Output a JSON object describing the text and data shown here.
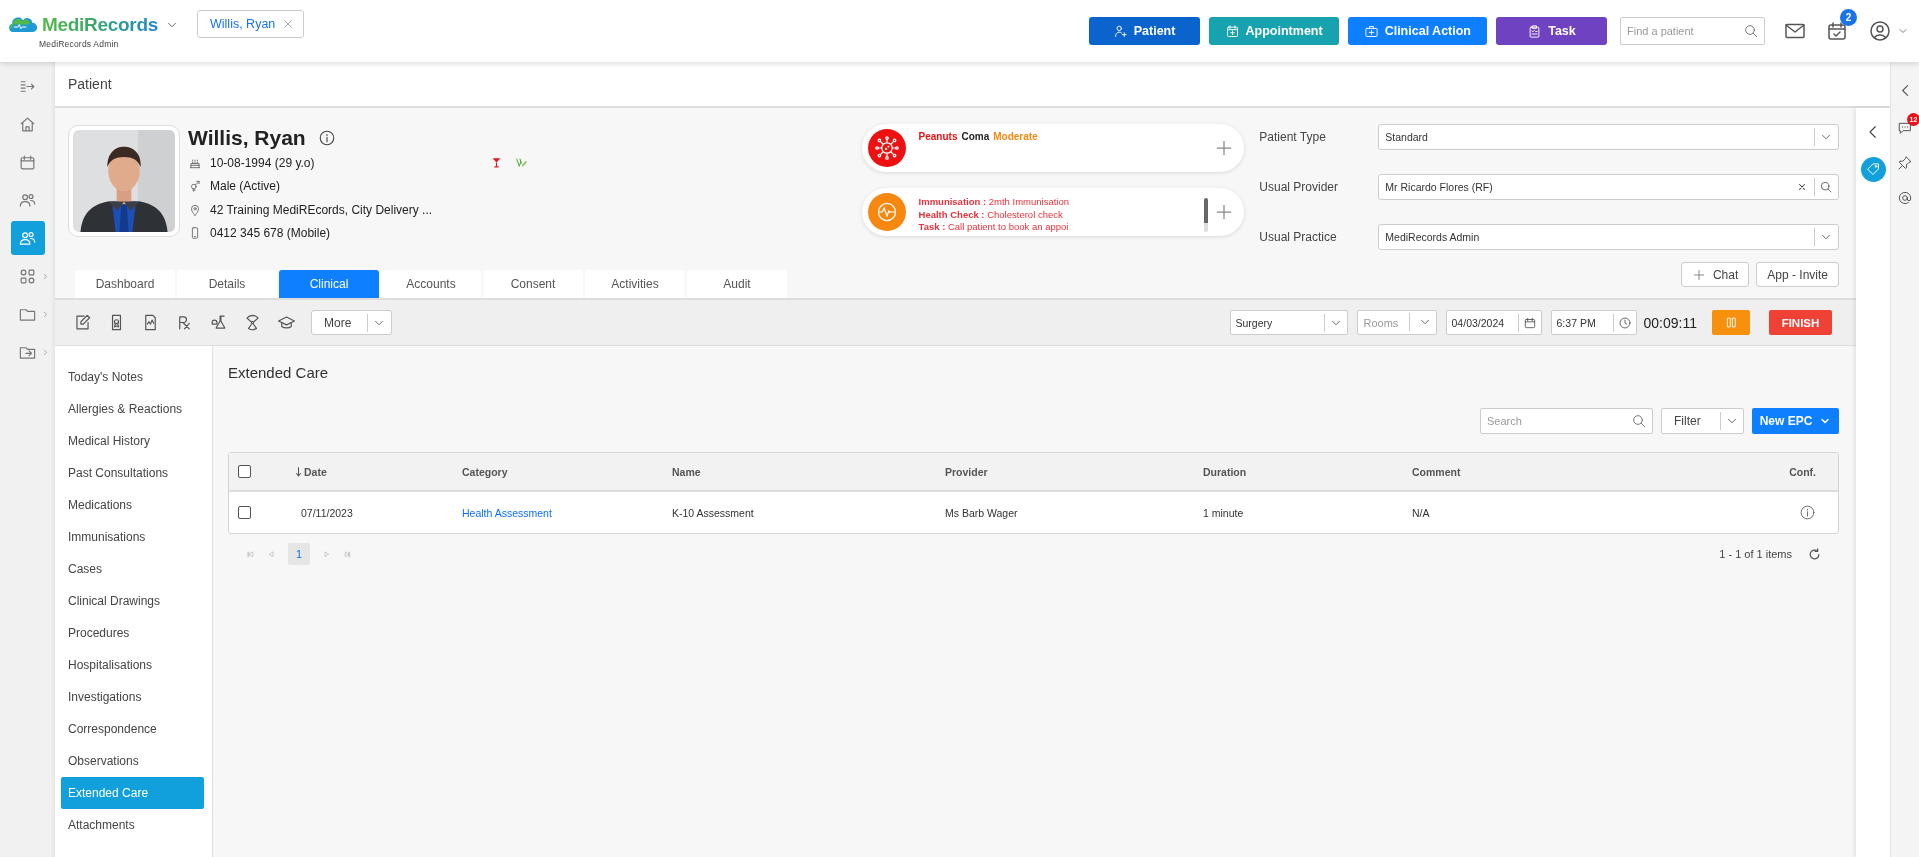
{
  "app": {
    "brand": "MediRecords",
    "subtitle": "MediRecords Admin"
  },
  "open_patient_tab": {
    "label": "Willis, Ryan"
  },
  "header_buttons": [
    {
      "label": "Patient",
      "kind": "patient",
      "color": "#0b63ce"
    },
    {
      "label": "Appointment",
      "kind": "appointment",
      "color": "#17a2b0"
    },
    {
      "label": "Clinical Action",
      "kind": "clinical",
      "color": "#0d7fff"
    },
    {
      "label": "Task",
      "kind": "task",
      "color": "#6f42c1"
    }
  ],
  "patient_search": {
    "placeholder": "Find a patient"
  },
  "calendar_badge": "2",
  "rail": [
    {
      "kind": "collapse",
      "selected": false,
      "submenu": false
    },
    {
      "kind": "home",
      "selected": false,
      "submenu": false
    },
    {
      "kind": "calendar",
      "selected": false,
      "submenu": false
    },
    {
      "kind": "contacts",
      "selected": false,
      "submenu": false
    },
    {
      "kind": "patients",
      "selected": true,
      "submenu": false
    },
    {
      "kind": "apps",
      "selected": false,
      "submenu": true
    },
    {
      "kind": "folder",
      "selected": false,
      "submenu": true
    },
    {
      "kind": "export",
      "selected": false,
      "submenu": true
    }
  ],
  "page_title": "Patient",
  "patient": {
    "name": "Willis, Ryan",
    "rows": [
      {
        "kind": "dob",
        "text": "10-08-1994 (29 y.o)"
      },
      {
        "kind": "gender",
        "text": "Male (Active)"
      },
      {
        "kind": "address",
        "text": "42 Training MediREcords, City Delivery ..."
      },
      {
        "kind": "phone",
        "text": "0412 345 678 (Mobile)"
      }
    ]
  },
  "alerts": [
    {
      "kind": "allergy",
      "parts": [
        {
          "kind": "allergen",
          "text": "Peanuts"
        },
        {
          "kind": "reaction",
          "text": "Coma"
        },
        {
          "kind": "severity",
          "text": "Moderate"
        }
      ]
    },
    {
      "kind": "reminders",
      "lines": [
        "**Immunisation :** 2mth Immunisation",
        "**Health Check :** Cholesterol check",
        "**Task :** Call patient to book an appoi"
      ]
    }
  ],
  "fields": [
    {
      "label": "Patient Type",
      "value": "Standard",
      "kind": "select"
    },
    {
      "label": "Usual Provider",
      "value": "Mr Ricardo Flores (RF)",
      "kind": "lookup"
    },
    {
      "label": "Usual Practice",
      "value": "MediRecords Admin",
      "kind": "select"
    }
  ],
  "actions": [
    {
      "kind": "chat",
      "label": "Chat"
    },
    {
      "kind": "invite",
      "label": "App - Invite"
    }
  ],
  "tabs": [
    {
      "label": "Dashboard",
      "selected": false
    },
    {
      "label": "Details",
      "selected": false
    },
    {
      "label": "Clinical",
      "selected": true
    },
    {
      "label": "Accounts",
      "selected": false
    },
    {
      "label": "Consent",
      "selected": false
    },
    {
      "label": "Activities",
      "selected": false
    },
    {
      "label": "Audit",
      "selected": false
    }
  ],
  "toolbar": {
    "tools": [
      {
        "kind": "note"
      },
      {
        "kind": "certificate"
      },
      {
        "kind": "report"
      },
      {
        "kind": "rx"
      },
      {
        "kind": "lab"
      },
      {
        "kind": "radiation"
      },
      {
        "kind": "education"
      }
    ],
    "more": "More",
    "location": "Surgery",
    "room_placeholder": "Rooms",
    "date": "04/03/2024",
    "time": "6:37 PM",
    "timer": "00:09:11",
    "running": true,
    "finish": "FINISH"
  },
  "nav": [
    {
      "label": "Today's Notes",
      "selected": false
    },
    {
      "label": "Allergies & Reactions",
      "selected": false
    },
    {
      "label": "Medical History",
      "selected": false
    },
    {
      "label": "Past Consultations",
      "selected": false
    },
    {
      "label": "Medications",
      "selected": false
    },
    {
      "label": "Immunisations",
      "selected": false
    },
    {
      "label": "Cases",
      "selected": false
    },
    {
      "label": "Clinical Drawings",
      "selected": false
    },
    {
      "label": "Procedures",
      "selected": false
    },
    {
      "label": "Hospitalisations",
      "selected": false
    },
    {
      "label": "Investigations",
      "selected": false
    },
    {
      "label": "Correspondence",
      "selected": false
    },
    {
      "label": "Observations",
      "selected": false
    },
    {
      "label": "Extended Care",
      "selected": true
    },
    {
      "label": "Attachments",
      "selected": false
    }
  ],
  "section": {
    "title": "Extended Care",
    "search_placeholder": "Search",
    "filter": "Filter",
    "new_button": "New EPC"
  },
  "table": {
    "all_checked": false,
    "columns": [
      {
        "label": "Date",
        "sort_descending": true
      },
      {
        "label": "Category"
      },
      {
        "label": "Name"
      },
      {
        "label": "Provider"
      },
      {
        "label": "Duration"
      },
      {
        "label": "Comment"
      },
      {
        "label": "Conf."
      }
    ],
    "rows": [
      {
        "checked": false,
        "cells": [
          {
            "kind": "text",
            "text": "07/11/2023"
          },
          {
            "kind": "link",
            "text": "Health Assessment"
          },
          {
            "kind": "text",
            "text": "K-10 Assessment"
          },
          {
            "kind": "text",
            "text": "Ms Barb Wager"
          },
          {
            "kind": "text",
            "text": "1 minute"
          },
          {
            "kind": "text",
            "text": "N/A"
          },
          {
            "kind": "info"
          }
        ]
      }
    ]
  },
  "pager": {
    "pages": [
      {
        "label": "1",
        "selected": true
      }
    ],
    "summary": "1 - 1 of 1 items"
  },
  "side_panel": {
    "badge": "12"
  }
}
